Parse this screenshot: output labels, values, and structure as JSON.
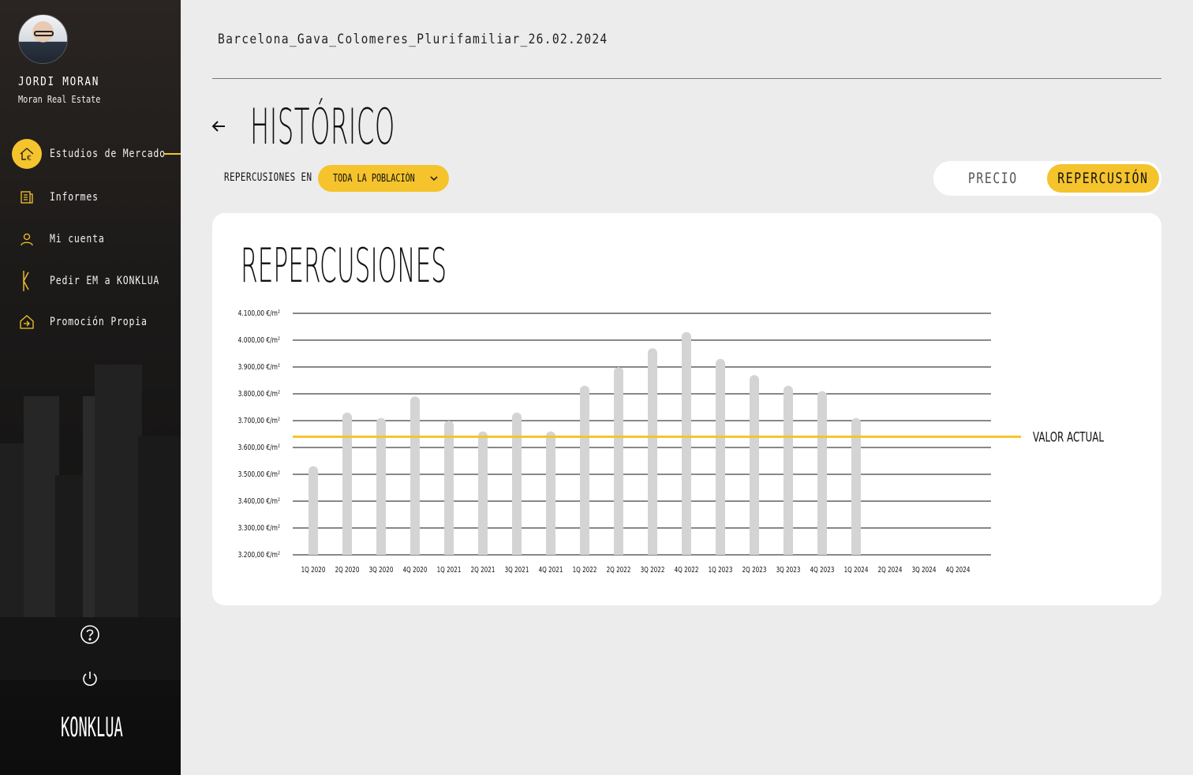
{
  "user": {
    "name": "JORDI MORAN",
    "company": "Moran Real Estate"
  },
  "nav": {
    "items": [
      {
        "label": "Estudios de Mercado",
        "icon": "house-euro-icon",
        "active": true
      },
      {
        "label": "Informes",
        "icon": "report-icon",
        "active": false
      },
      {
        "label": "Mi cuenta",
        "icon": "user-icon",
        "active": false
      },
      {
        "label": "Pedir EM a KONKLUA",
        "icon": "konklua-k-icon",
        "active": false
      },
      {
        "label": "Promoción Propia",
        "icon": "house-arrow-icon",
        "active": false
      }
    ]
  },
  "brand": "KONKLUA",
  "header": {
    "file_name": "Barcelona_Gava_Colomeres_Plurifamiliar_26.02.2024"
  },
  "page": {
    "title": "HISTÓRICO"
  },
  "filter": {
    "label": "REPERCUSIONES EN",
    "selected": "TODA LA POBLACIÓN"
  },
  "toggle": {
    "option_price": "PRECIO",
    "option_repercussion": "REPERCUSIÓN",
    "selected": "REPERCUSIÓN"
  },
  "colors": {
    "accent": "#f5c32c",
    "bar": "#d4d4d4",
    "sidebar": "#141414"
  },
  "chart_data": {
    "type": "bar",
    "title": "REPERCUSIONES",
    "categories": [
      "1Q 2020",
      "2Q 2020",
      "3Q 2020",
      "4Q 2020",
      "1Q 2021",
      "2Q 2021",
      "3Q 2021",
      "4Q 2021",
      "1Q 2022",
      "2Q 2022",
      "3Q 2022",
      "4Q 2022",
      "1Q 2023",
      "2Q 2023",
      "3Q 2023",
      "4Q 2023",
      "1Q 2024",
      "2Q 2024",
      "3Q 2024",
      "4Q 2024"
    ],
    "values": [
      3530,
      3730,
      3710,
      3790,
      3700,
      3660,
      3730,
      3660,
      3830,
      3900,
      3970,
      4030,
      3930,
      3870,
      3830,
      3810,
      3710,
      null,
      null,
      null
    ],
    "ylim": [
      3200,
      4100
    ],
    "yticks": [
      4100,
      4000,
      3900,
      3800,
      3700,
      3600,
      3500,
      3400,
      3300,
      3200
    ],
    "ytick_labels": [
      "4.100,00 €/m²",
      "4.000,00 €/m²",
      "3.900,00 €/m²",
      "3.800,00 €/m²",
      "3.700,00 €/m²",
      "3.600,00 €/m²",
      "3.500,00 €/m²",
      "3.400,00 €/m²",
      "3.300,00 €/m²",
      "3.200,00 €/m²"
    ],
    "reference_line": {
      "label": "VALOR ACTUAL",
      "value": 3640,
      "color": "#f5c32c"
    },
    "grid": true
  }
}
